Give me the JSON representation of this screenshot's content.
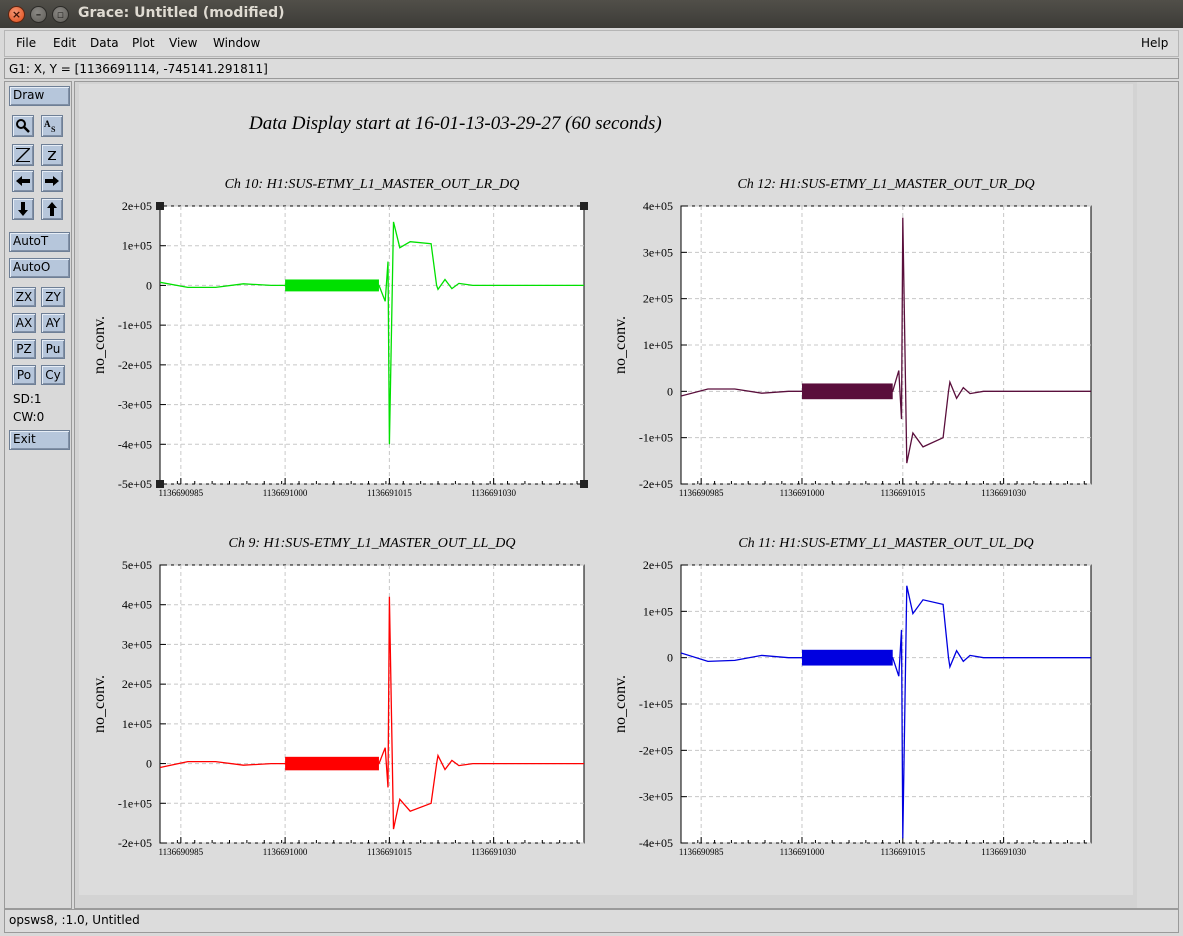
{
  "window": {
    "title": "Grace: Untitled (modified)"
  },
  "menu": {
    "file": "File",
    "edit": "Edit",
    "data": "Data",
    "plot": "Plot",
    "view": "View",
    "window": "Window",
    "help": "Help"
  },
  "locator": "G1: X, Y = [1136691114, -745141.291811]",
  "toolbar": {
    "draw": "Draw",
    "autot": "AutoT",
    "autoo": "AutoO",
    "zx": "ZX",
    "zy": "ZY",
    "ax": "AX",
    "ay": "AY",
    "pz": "PZ",
    "pu": "Pu",
    "po": "Po",
    "cy": "Cy",
    "sd": "SD:1",
    "cw": "CW:0",
    "exit": "Exit"
  },
  "status": "opsws8, :1.0, Untitled",
  "page_title": "Data Display start at 16-01-13-03-29-27 (60 seconds)",
  "chart_data": [
    {
      "type": "line",
      "title": "Ch 10: H1:SUS-ETMY_L1_MASTER_OUT_LR_DQ",
      "ylabel": "no_conv.",
      "color": "#00e000",
      "xlim": [
        1136690982,
        1136691043
      ],
      "ylim": [
        -500000,
        200000
      ],
      "xticks": [
        "1136690985",
        "1136691000",
        "1136691015",
        "1136691030"
      ],
      "yticks": [
        "2e+05",
        "1e+05",
        "0",
        "-1e+05",
        "-2e+05",
        "-3e+05",
        "-4e+05",
        "-5e+05"
      ],
      "band": [
        1136691000,
        1136691013.5,
        15000
      ],
      "x": [
        1136690982,
        1136690986,
        1136690990,
        1136690994,
        1136690998,
        1136691000,
        1136691013.5,
        1136691014.4,
        1136691014.8,
        1136691015,
        1136691015.6,
        1136691016.5,
        1136691018,
        1136691021,
        1136691021.8,
        1136691022,
        1136691023,
        1136691024,
        1136691025,
        1136691027,
        1136691030,
        1136691035,
        1136691043
      ],
      "y": [
        8000,
        -5000,
        -5000,
        4000,
        0,
        0,
        0,
        -40000,
        60000,
        -400000,
        160000,
        95000,
        110000,
        105000,
        0,
        -10000,
        15000,
        -8000,
        5000,
        0,
        0,
        0,
        0
      ]
    },
    {
      "type": "line",
      "title": "Ch 12: H1:SUS-ETMY_L1_MASTER_OUT_UR_DQ",
      "ylabel": "no_conv.",
      "color": "#5a0f3c",
      "xlim": [
        1136690982,
        1136691043
      ],
      "ylim": [
        -200000,
        400000
      ],
      "xticks": [
        "1136690985",
        "1136691000",
        "1136691015",
        "1136691030"
      ],
      "yticks": [
        "4e+05",
        "3e+05",
        "2e+05",
        "1e+05",
        "0",
        "-1e+05",
        "-2e+05"
      ],
      "band": [
        1136691000,
        1136691013.5,
        17000
      ],
      "x": [
        1136690982,
        1136690986,
        1136690990,
        1136690994,
        1136690998,
        1136691000,
        1136691013.5,
        1136691014.4,
        1136691014.8,
        1136691015,
        1136691015.6,
        1136691016.5,
        1136691018,
        1136691021,
        1136691021.8,
        1136691022,
        1136691023,
        1136691024,
        1136691025,
        1136691027,
        1136691030,
        1136691035,
        1136691043
      ],
      "y": [
        -10000,
        5000,
        5000,
        -4000,
        0,
        0,
        0,
        45000,
        -60000,
        375000,
        -155000,
        -90000,
        -120000,
        -100000,
        0,
        20000,
        -15000,
        8000,
        -5000,
        0,
        0,
        0,
        0
      ]
    },
    {
      "type": "line",
      "title": "Ch 9: H1:SUS-ETMY_L1_MASTER_OUT_LL_DQ",
      "ylabel": "no_conv.",
      "color": "#ff0000",
      "xlim": [
        1136690982,
        1136691043
      ],
      "ylim": [
        -200000,
        500000
      ],
      "xticks": [
        "1136690985",
        "1136691000",
        "1136691015",
        "1136691030"
      ],
      "yticks": [
        "5e+05",
        "4e+05",
        "3e+05",
        "2e+05",
        "1e+05",
        "0",
        "-1e+05",
        "-2e+05"
      ],
      "band": [
        1136691000,
        1136691013.5,
        17000
      ],
      "x": [
        1136690982,
        1136690986,
        1136690990,
        1136690994,
        1136690998,
        1136691000,
        1136691013.5,
        1136691014.4,
        1136691014.8,
        1136691015,
        1136691015.6,
        1136691016.5,
        1136691018,
        1136691021,
        1136691021.8,
        1136691022,
        1136691023,
        1136691024,
        1136691025,
        1136691027,
        1136691030,
        1136691035,
        1136691043
      ],
      "y": [
        -10000,
        5000,
        5000,
        -4000,
        0,
        0,
        0,
        40000,
        -60000,
        420000,
        -165000,
        -90000,
        -120000,
        -100000,
        0,
        20000,
        -15000,
        8000,
        -5000,
        0,
        0,
        0,
        0
      ]
    },
    {
      "type": "line",
      "title": "Ch 11: H1:SUS-ETMY_L1_MASTER_OUT_UL_DQ",
      "ylabel": "no_conv.",
      "color": "#0000e0",
      "xlim": [
        1136690982,
        1136691043
      ],
      "ylim": [
        -400000,
        200000
      ],
      "xticks": [
        "1136690985",
        "1136691000",
        "1136691015",
        "1136691030"
      ],
      "yticks": [
        "2e+05",
        "1e+05",
        "0",
        "-1e+05",
        "-2e+05",
        "-3e+05",
        "-4e+05"
      ],
      "band": [
        1136691000,
        1136691013.5,
        17000
      ],
      "x": [
        1136690982,
        1136690986,
        1136690990,
        1136690994,
        1136690998,
        1136691000,
        1136691013.5,
        1136691014.4,
        1136691014.8,
        1136691015,
        1136691015.6,
        1136691016.5,
        1136691018,
        1136691021,
        1136691021.8,
        1136691022,
        1136691023,
        1136691024,
        1136691025,
        1136691027,
        1136691030,
        1136691035,
        1136691043
      ],
      "y": [
        10000,
        -8000,
        -6000,
        5000,
        0,
        0,
        0,
        -40000,
        60000,
        -390000,
        155000,
        95000,
        125000,
        115000,
        0,
        -20000,
        15000,
        -8000,
        5000,
        0,
        0,
        0,
        0
      ]
    }
  ]
}
